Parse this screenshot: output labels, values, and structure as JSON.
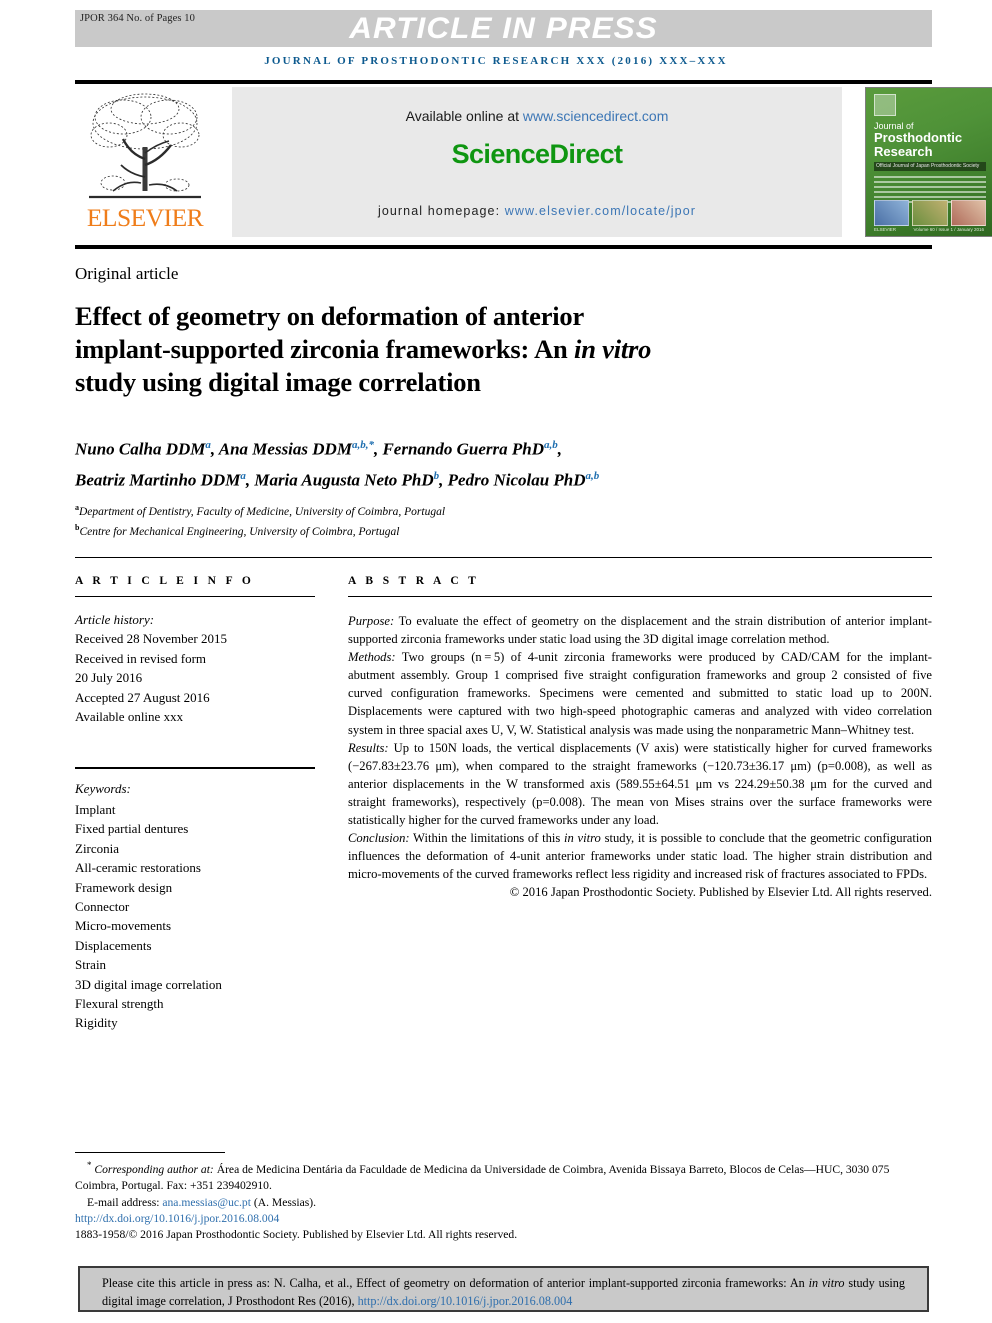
{
  "header": {
    "jpor_code": "JPOR 364 No. of Pages 10",
    "article_in_press": "ARTICLE IN PRESS",
    "journal_line": "JOURNAL OF PROSTHODONTIC RESEARCH XXX (2016) XXX–XXX"
  },
  "banner": {
    "elsevier_wordmark": "ELSEVIER",
    "available_prefix": "Available online at ",
    "sciencedirect_url": "www.sciencedirect.com",
    "sciencedirect_logo": "ScienceDirect",
    "homepage_prefix": "journal homepage: ",
    "homepage_url": "www.elsevier.com/locate/jpor",
    "cover": {
      "line1": "Journal of",
      "line2": "Prosthodontic\nResearch",
      "band": "Official Journal of Japan Prosthodontic Society",
      "foot_left": "ELSEVIER",
      "foot_right": "Volume 60 / Issue 1 / January 2016"
    }
  },
  "article": {
    "kicker": "Original article",
    "title_line1": "Effect of geometry on deformation of anterior",
    "title_line2_a": "implant-supported zirconia frameworks: An ",
    "title_line2_i": "in vitro",
    "title_line3": "study using digital image correlation",
    "authors_line1": "Nuno Calha DDM",
    "authors": [
      {
        "name": "Nuno Calha DDM",
        "sup": "a"
      },
      {
        "name": "Ana Messias DDM",
        "sup": "a,b,*"
      },
      {
        "name": "Fernando Guerra PhD",
        "sup": "a,b"
      },
      {
        "name": "Beatriz Martinho DDM",
        "sup": "a"
      },
      {
        "name": "Maria Augusta Neto PhD",
        "sup": "b"
      },
      {
        "name": "Pedro Nicolau PhD",
        "sup": "a,b"
      }
    ],
    "affiliations": [
      {
        "sup": "a",
        "text": "Department of Dentistry, Faculty of Medicine, University of Coimbra, Portugal"
      },
      {
        "sup": "b",
        "text": "Centre for Mechanical Engineering, University of Coimbra, Portugal"
      }
    ]
  },
  "info": {
    "heading": "A R T I C L E   I N F O",
    "history_label": "Article history:",
    "history": [
      "Received 28 November 2015",
      "Received in revised form",
      "20 July 2016",
      "Accepted 27 August 2016",
      "Available online xxx"
    ],
    "keywords_label": "Keywords:",
    "keywords": [
      "Implant",
      "Fixed partial dentures",
      "Zirconia",
      "All-ceramic restorations",
      "Framework design",
      "Connector",
      "Micro-movements",
      "Displacements",
      "Strain",
      "3D digital image correlation",
      "Flexural strength",
      "Rigidity"
    ]
  },
  "abstract": {
    "heading": "A B S T R A C T",
    "purpose_label": "Purpose:",
    "purpose_text": " To evaluate the effect of geometry on the displacement and the strain distribution of anterior implant-supported zirconia frameworks under static load using the 3D digital image correlation method.",
    "methods_label": "Methods:",
    "methods_text": " Two groups (n = 5) of 4-unit zirconia frameworks were produced by CAD/CAM for the implant-abutment assembly. Group 1 comprised five straight configuration frameworks and group 2 consisted of five curved configuration frameworks. Specimens were cemented and submitted to static load up to 200N. Displacements were captured with two high-speed photographic cameras and analyzed with video correlation system in three spacial axes U, V, W. Statistical analysis was made using the nonparametric Mann–Whitney test.",
    "results_label": "Results:",
    "results_text": " Up to 150N loads, the vertical displacements (V axis) were statistically higher for curved frameworks (−267.83±23.76 μm), when compared to the straight frameworks (−120.73±36.17 μm) (p=0.008), as well as anterior displacements in the W transformed axis (589.55±64.51 μm vs 224.29±50.38 μm for the curved and straight frameworks), respectively (p=0.008). The mean von Mises strains over the surface frameworks were statistically higher for the curved frameworks under any load.",
    "conclusion_label": "Conclusion:",
    "conclusion_a": " Within the limitations of this ",
    "conclusion_i": "in vitro",
    "conclusion_b": " study, it is possible to conclude that the geometric configuration influences the deformation of 4-unit anterior frameworks under static load. The higher strain distribution and micro-movements of the curved frameworks reflect less rigidity and increased risk of fractures associated to FPDs.",
    "copyright": "© 2016 Japan Prosthodontic Society. Published by Elsevier Ltd. All rights reserved."
  },
  "footnotes": {
    "corresponding_label": "Corresponding author at:",
    "corresponding_text": " Área de Medicina Dentária da Faculdade de Medicina da Universidade de Coimbra, Avenida Bissaya Barreto, Blocos de Celas—HUC, 3030 075 Coimbra, Portugal. Fax: +351 239402910.",
    "email_label": "E-mail address:",
    "email_address": "ana.messias@uc.pt",
    "email_owner": " (A. Messias).",
    "doi": "http://dx.doi.org/10.1016/j.jpor.2016.08.004",
    "issn_line": "1883-1958/© 2016 Japan Prosthodontic Society. Published by Elsevier Ltd. All rights reserved."
  },
  "cite_box": {
    "text": "Please cite this article in press as: N. Calha, et al., Effect of geometry on deformation of anterior implant-supported zirconia frameworks: An ",
    "italic": "in vitro",
    "text2": " study using digital image correlation, J Prosthodont Res (2016), ",
    "link": "http://dx.doi.org/10.1016/j.jpor.2016.08.004"
  },
  "colors": {
    "journal_blue": "#0d5a8f",
    "link_blue": "#2f6fad",
    "sciencedirect_green": "#0f9611",
    "elsevier_orange": "#ef7d1a",
    "bar_gray": "#c9c9c9"
  }
}
